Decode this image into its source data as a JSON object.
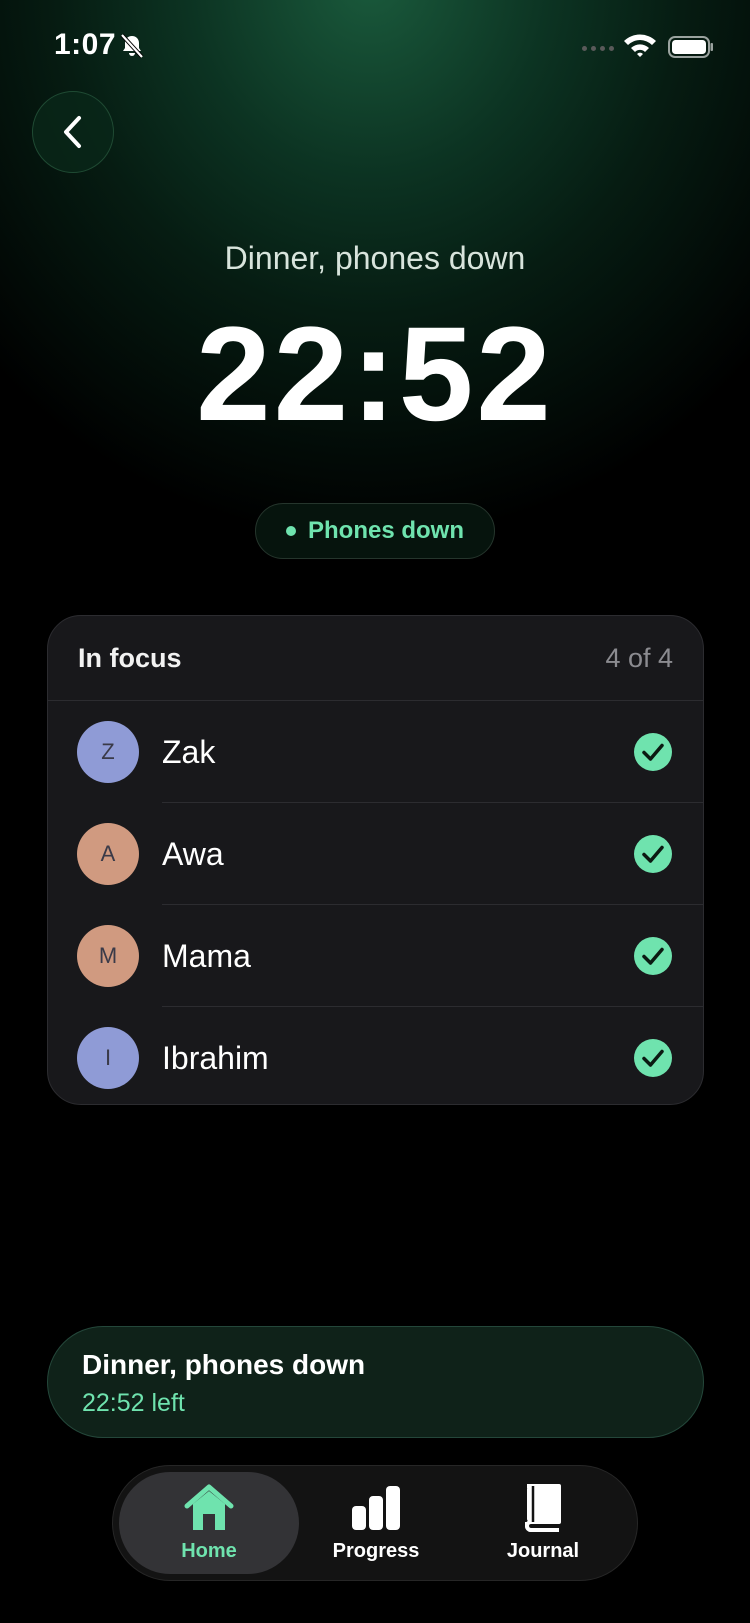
{
  "status_bar": {
    "time": "1:07"
  },
  "colors": {
    "accent": "#6fe3ae",
    "avatar_blue": "#8f9bd6",
    "avatar_peach": "#d09a80"
  },
  "session": {
    "title": "Dinner, phones down",
    "timer": "22:52",
    "status": "Phones down"
  },
  "focus": {
    "title": "In focus",
    "count": "4 of 4",
    "members": [
      {
        "initial": "Z",
        "name": "Zak",
        "avatar_color": "#8f9bd6"
      },
      {
        "initial": "A",
        "name": "Awa",
        "avatar_color": "#d09a80"
      },
      {
        "initial": "M",
        "name": "Mama",
        "avatar_color": "#d09a80"
      },
      {
        "initial": "I",
        "name": "Ibrahim",
        "avatar_color": "#8f9bd6"
      }
    ]
  },
  "mini_bar": {
    "title": "Dinner, phones down",
    "subtitle": "22:52 left"
  },
  "tabs": [
    {
      "label": "Home",
      "icon": "home-icon",
      "active": true
    },
    {
      "label": "Progress",
      "icon": "bar-chart-icon",
      "active": false
    },
    {
      "label": "Journal",
      "icon": "book-icon",
      "active": false
    }
  ]
}
